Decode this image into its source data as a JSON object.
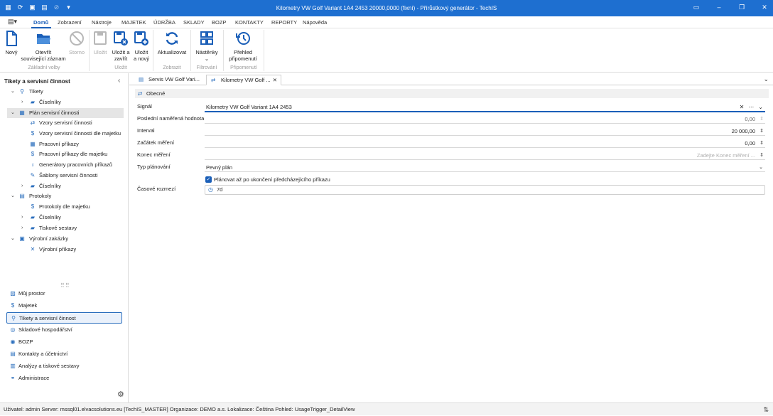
{
  "window": {
    "title": "Kilometry VW Golf Variant 1A4 2453 20000,0000 (fixní) - Přírůstkový generátor - TechIS"
  },
  "quick_access": [
    {
      "name": "app-menu-icon",
      "glyph": "⟐"
    },
    {
      "name": "refresh-icon",
      "glyph": "⟳"
    },
    {
      "name": "save-icon",
      "glyph": "▣"
    },
    {
      "name": "save-close-icon",
      "glyph": "▤"
    },
    {
      "name": "cancel-icon",
      "glyph": "⊘"
    },
    {
      "name": "customize-icon",
      "glyph": "▾"
    }
  ],
  "menu": {
    "items": [
      "Domů",
      "Zobrazení",
      "Nástroje",
      "MAJETEK",
      "ÚDRŽBA",
      "SKLADY",
      "BOZP",
      "KONTAKTY",
      "REPORTY",
      "Nápověda"
    ],
    "active": "Domů"
  },
  "ribbon": {
    "new": "Nový",
    "open_related_1": "Otevřít",
    "open_related_2": "související záznam",
    "storno": "Storno",
    "save": "Uložit",
    "save_close_1": "Uložit a",
    "save_close_2": "zavřít",
    "save_new_1": "Uložit",
    "save_new_2": "a nový",
    "refresh": "Aktualizovat",
    "boards": "Nástěnky",
    "reminders_1": "Přehled",
    "reminders_2": "připomenutí",
    "groups": {
      "basic": "Základní volby",
      "save": "Uložit",
      "view": "Zobrazit",
      "filter": "Filtrování",
      "reminders": "Připomenutí"
    }
  },
  "sidebar": {
    "header": "Tikety a servisní činnost",
    "tree": [
      {
        "label": "Tikety",
        "icon": "search-icon"
      },
      {
        "label": "Číselníky",
        "icon": "folder-icon"
      },
      {
        "label": "Plán servisní činnosti",
        "icon": "calendar-icon"
      },
      {
        "label": "Vzory servisní činnosti",
        "icon": "sync-icon"
      },
      {
        "label": "Vzory servisní činnosti dle majetku",
        "icon": "dollar-icon"
      },
      {
        "label": "Pracovní příkazy",
        "icon": "calendar-icon"
      },
      {
        "label": "Pracovní příkazy dle majetku",
        "icon": "dollar-icon"
      },
      {
        "label": "Generátory pracovních příkazů",
        "icon": "bulb-icon"
      },
      {
        "label": "Šablony servisní činnosti",
        "icon": "template-icon"
      },
      {
        "label": "Číselníky",
        "icon": "folder-icon"
      },
      {
        "label": "Protokoly",
        "icon": "document-icon"
      },
      {
        "label": "Protokoly dle majetku",
        "icon": "dollar-icon"
      },
      {
        "label": "Číselníky",
        "icon": "folder-icon"
      },
      {
        "label": "Tiskové sestavy",
        "icon": "folder-icon"
      },
      {
        "label": "Výrobní zakázky",
        "icon": "factory-icon"
      },
      {
        "label": "Výrobní příkazy",
        "icon": "tools-icon"
      }
    ],
    "nav": [
      {
        "label": "Můj prostor",
        "icon": "workspace-icon"
      },
      {
        "label": "Majetek",
        "icon": "dollar-icon"
      },
      {
        "label": "Tikety a servisní činnost",
        "icon": "search-icon"
      },
      {
        "label": "Skladové hospodářství",
        "icon": "warehouse-icon"
      },
      {
        "label": "BOZP",
        "icon": "safety-icon"
      },
      {
        "label": "Kontakty a účetnictví",
        "icon": "contacts-icon"
      },
      {
        "label": "Analýzy a tiskové sestavy",
        "icon": "report-icon"
      },
      {
        "label": "Administrace",
        "icon": "admin-icon"
      }
    ]
  },
  "tabs": [
    {
      "label": "Servis VW Golf Vari..."
    },
    {
      "label": "Kilometry VW Golf ..."
    }
  ],
  "form": {
    "section": "Obecné",
    "signal_label": "Signál",
    "signal_value": "Kilometry VW Golf Variant 1A4 2453",
    "last_value_label": "Poslední naměřená hodnota",
    "last_value": "0,00",
    "interval_label": "Interval",
    "interval_value": "20 000,00",
    "start_label": "Začátek měření",
    "start_value": "0,00",
    "end_label": "Konec měření",
    "end_placeholder": "Zadejte Konec měření ...",
    "plan_type_label": "Typ plánování",
    "plan_type_value": "Pevný plán",
    "plan_after_label": "Plánovat až po ukončení předcházejícího příkazu",
    "time_range_label": "Časové rozmezí",
    "time_range_value": "7d"
  },
  "status": {
    "text": "Uživatel: admin  Server: mssql01.elvacsolutions.eu [TechIS_MASTER]  Organizace: DEMO a.s.  Lokalizace: Čeština  Pohled: UsageTrigger_DetailView"
  }
}
